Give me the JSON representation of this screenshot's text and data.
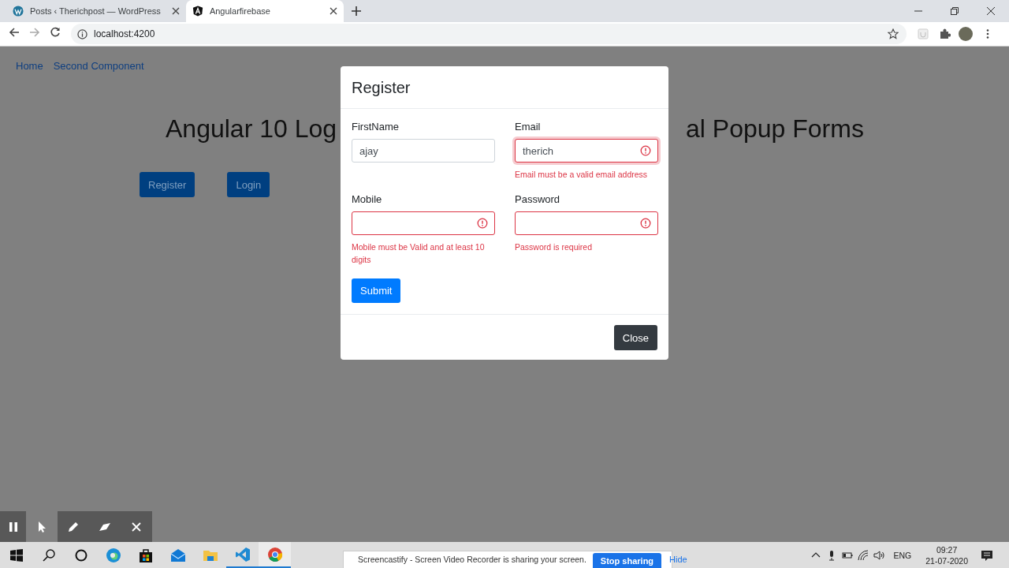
{
  "browser": {
    "tabs": [
      {
        "title": "Posts ‹ Therichpost — WordPress",
        "selected": false
      },
      {
        "title": "Angularfirebase",
        "selected": true
      }
    ],
    "address": "localhost:4200"
  },
  "page": {
    "nav": [
      "Home",
      "Second Component"
    ],
    "heading_parts": [
      "Angular 10 Log",
      "al Popup Forms"
    ],
    "buttons": [
      "Register",
      "Login"
    ]
  },
  "modal": {
    "title": "Register",
    "fields": [
      {
        "label": "FirstName",
        "value": "ajay",
        "invalid": false,
        "focused": false
      },
      {
        "label": "Email",
        "value": "therich",
        "invalid": true,
        "focused": true,
        "error": "Email must be a valid email address"
      },
      {
        "label": "Mobile",
        "invalid": true,
        "focused": false,
        "error": "Mobile must be Valid and at least 10 digits"
      },
      {
        "label": "Password",
        "invalid": true,
        "focused": false,
        "error": "Password is required"
      }
    ],
    "submit": "Submit",
    "close": "Close"
  },
  "taskbar": {
    "apps": [
      {
        "kind": "edge",
        "running": false
      },
      {
        "kind": "store",
        "running": false
      },
      {
        "kind": "mail",
        "running": false
      },
      {
        "kind": "explorer",
        "running": false
      },
      {
        "kind": "vscode",
        "running": true
      },
      {
        "kind": "chrome",
        "running": true
      }
    ],
    "language": "ENG",
    "time": "09:27",
    "date": "21-07-2020"
  },
  "sharing_bar": {
    "message": "Screencastify - Screen Video Recorder is sharing your screen.",
    "stop": "Stop sharing",
    "hide": "Hide"
  }
}
